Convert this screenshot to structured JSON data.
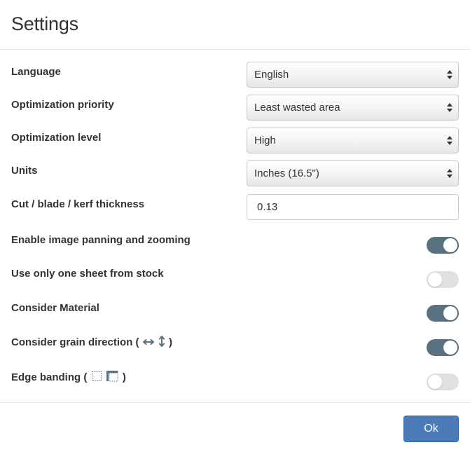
{
  "dialog": {
    "title": "Settings"
  },
  "settings": {
    "language": {
      "label": "Language",
      "value": "English"
    },
    "optimization_priority": {
      "label": "Optimization priority",
      "value": "Least wasted area"
    },
    "optimization_level": {
      "label": "Optimization level",
      "value": "High"
    },
    "units": {
      "label": "Units",
      "value": "Inches (16.5\")"
    },
    "kerf": {
      "label": "Cut / blade / kerf thickness",
      "value": "0.13"
    },
    "panning_zooming": {
      "label": "Enable image panning and zooming",
      "enabled": true
    },
    "one_sheet": {
      "label": "Use only one sheet from stock",
      "enabled": false
    },
    "material": {
      "label": "Consider Material",
      "enabled": true
    },
    "grain": {
      "label_prefix": "Consider grain direction (",
      "label_suffix": ")",
      "enabled": true
    },
    "edge_banding": {
      "label_prefix": "Edge banding (",
      "label_suffix": ")",
      "enabled": false
    }
  },
  "footer": {
    "ok_label": "Ok"
  },
  "colors": {
    "toggle_on": "#5a7180",
    "toggle_off": "#e0e0e0",
    "primary_button": "#4a7ab7",
    "grain_icon": "#5a7180"
  },
  "icons": {
    "select_arrow": "up-down-chevron-icon",
    "grain_horizontal": "horizontal-arrows-icon",
    "grain_vertical": "vertical-arrows-icon",
    "edge_none": "dashed-square-icon",
    "edge_banded": "banded-square-icon"
  }
}
